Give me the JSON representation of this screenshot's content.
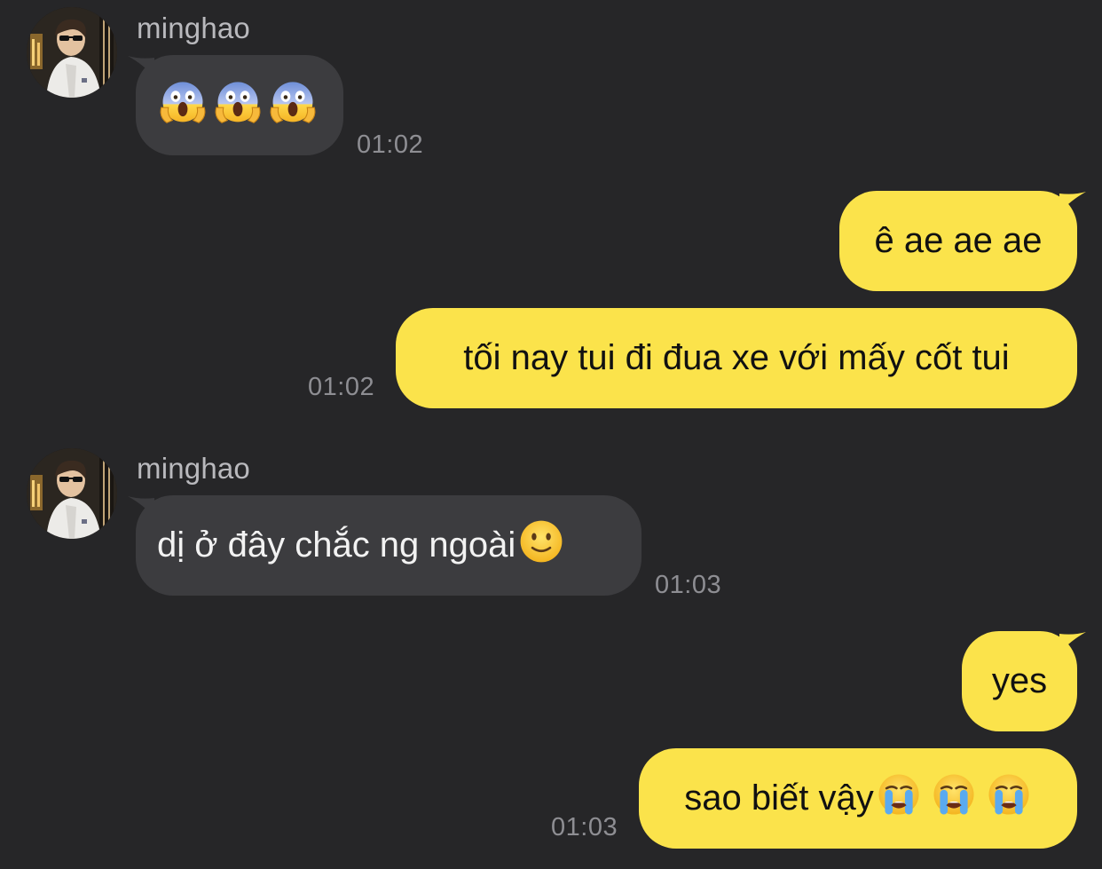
{
  "contact": {
    "name": "minghao"
  },
  "messages": [
    {
      "direction": "in",
      "sender": "minghao",
      "emojis": [
        "face-screaming-in-fear",
        "face-screaming-in-fear",
        "face-screaming-in-fear"
      ],
      "time": "01:02"
    },
    {
      "direction": "out",
      "text": "ê ae ae ae"
    },
    {
      "direction": "out",
      "text": "tối nay tui đi đua xe với mấy cốt tui",
      "time": "01:02"
    },
    {
      "direction": "in",
      "sender": "minghao",
      "text": "dị ở đây chắc ng ngoài",
      "emojis": [
        "slightly-smiling-face"
      ],
      "time": "01:03"
    },
    {
      "direction": "out",
      "text": "yes"
    },
    {
      "direction": "out",
      "text": "sao biết vậy",
      "emojis": [
        "loudly-crying-face",
        "loudly-crying-face",
        "loudly-crying-face"
      ],
      "time": "01:03"
    }
  ],
  "colors": {
    "background": "#262628",
    "incoming_bubble": "#3c3c3f",
    "outgoing_bubble": "#fbe34b",
    "timestamp": "#8e8e93",
    "sender_name": "#b9b9bd"
  }
}
